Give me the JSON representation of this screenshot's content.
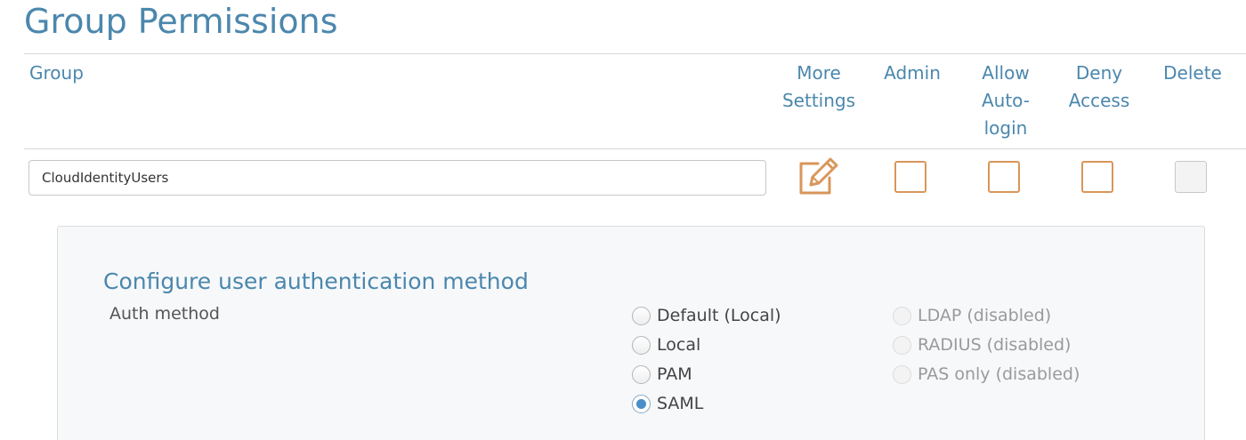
{
  "page": {
    "title": "Group Permissions"
  },
  "table": {
    "headers": {
      "group": "Group",
      "more_settings": [
        "More",
        "Settings"
      ],
      "admin": "Admin",
      "allow_autologin": [
        "Allow",
        "Auto-",
        "login"
      ],
      "deny_access": [
        "Deny",
        "Access"
      ],
      "delete": "Delete"
    },
    "row": {
      "group_name": "CloudIdentityUsers",
      "edit_icon": "edit-pencil-icon",
      "admin_checked": false,
      "allow_autologin_checked": false,
      "deny_access_checked": false,
      "delete_checked": false,
      "delete_disabled": true
    }
  },
  "auth_panel": {
    "title": "Configure user authentication method",
    "label": "Auth method",
    "options": [
      {
        "label": "Default (Local)",
        "checked": false,
        "disabled": false
      },
      {
        "label": "Local",
        "checked": false,
        "disabled": false
      },
      {
        "label": "PAM",
        "checked": false,
        "disabled": false
      },
      {
        "label": "SAML",
        "checked": true,
        "disabled": false
      },
      {
        "label": "LDAP (disabled)",
        "checked": false,
        "disabled": true
      },
      {
        "label": "RADIUS (disabled)",
        "checked": false,
        "disabled": true
      },
      {
        "label": "PAS only (disabled)",
        "checked": false,
        "disabled": true
      }
    ]
  },
  "colors": {
    "accent": "#4b87ad",
    "checkbox_border": "#d9965a",
    "radio_selected": "#4a8fc7"
  }
}
